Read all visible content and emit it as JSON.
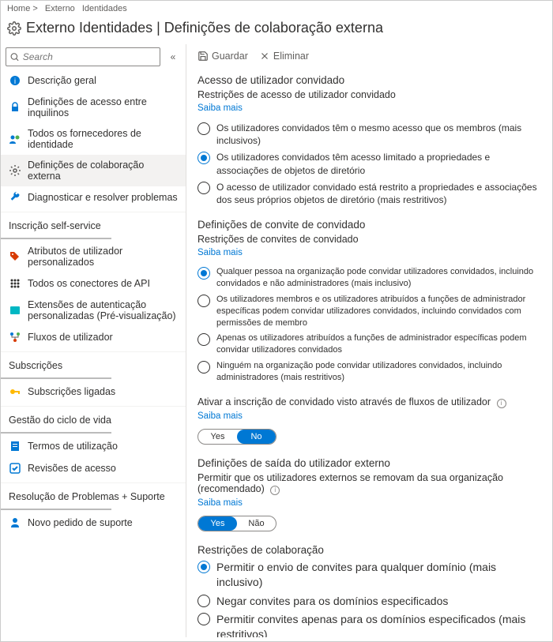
{
  "breadcrumb": {
    "home": "Home >",
    "l1": "Externo",
    "l2": "Identidades"
  },
  "header": {
    "title": "Externo  Identidades | Definições de colaboração externa"
  },
  "sidebar": {
    "search_placeholder": "Search",
    "items": [
      {
        "label": "Descrição geral",
        "icon": "info",
        "color": "#0078d4"
      },
      {
        "label": "Definições de acesso entre inquilinos",
        "icon": "lock",
        "color": "#0078d4"
      },
      {
        "label": "Todos os fornecedores de identidade",
        "icon": "people",
        "color": "#0078d4"
      },
      {
        "label": "Definições de colaboração externa",
        "icon": "gear",
        "color": "#605e5c",
        "selected": true
      },
      {
        "label": "Diagnosticar e resolver problemas",
        "icon": "wrench",
        "color": "#0078d4"
      }
    ],
    "groups": [
      {
        "label": "Inscrição self-service",
        "items": [
          {
            "label": "Atributos de utilizador personalizados",
            "icon": "tag",
            "color": "#d83b01"
          },
          {
            "label": "Todos os conectores de API",
            "icon": "grid",
            "color": "#323130"
          },
          {
            "label": "Extensões de autenticação personalizadas (Pré-visualização)",
            "icon": "square",
            "color": "#00b7c3"
          },
          {
            "label": "Fluxos de utilizador",
            "icon": "flow",
            "color": "#107c10"
          }
        ]
      },
      {
        "label": "Subscrições",
        "items": [
          {
            "label": "Subscrições ligadas",
            "icon": "key",
            "color": "#ffb900"
          }
        ]
      },
      {
        "label": "Gestão do ciclo de vida",
        "items": [
          {
            "label": "Termos de utilização",
            "icon": "doc",
            "color": "#0078d4"
          },
          {
            "label": "Revisões de acesso",
            "icon": "check",
            "color": "#0078d4"
          }
        ]
      },
      {
        "label": "Resolução de Problemas + Suporte",
        "items": [
          {
            "label": "Novo pedido de suporte",
            "icon": "person",
            "color": "#0078d4"
          }
        ]
      }
    ]
  },
  "toolbar": {
    "save_label": "Guardar",
    "delete_label": "Eliminar"
  },
  "sections": {
    "guest_access": {
      "title": "Acesso de utilizador convidado",
      "sub": "Restrições de acesso de utilizador convidado",
      "learn": "Saiba mais",
      "options": [
        "Os utilizadores convidados têm o mesmo acesso que os membros (mais inclusivos)",
        "Os utilizadores convidados têm acesso limitado a propriedades e associações de objetos de diretório",
        "O acesso de utilizador convidado está restrito a propriedades e associações dos seus próprios objetos de diretório (mais restritivos)"
      ],
      "selected": 1
    },
    "invite": {
      "title": "Definições de convite de convidado",
      "sub": "Restrições de convites de convidado",
      "learn": "Saiba mais",
      "options": [
        "Qualquer pessoa na organização pode convidar utilizadores convidados, incluindo convidados e não administradores (mais inclusivo)",
        "Os utilizadores membros e os utilizadores atribuídos a funções de administrador específicas podem convidar utilizadores convidados, incluindo convidados com permissões de membro",
        "Apenas os utilizadores atribuídos a funções de administrador específicas podem convidar utilizadores convidados",
        "Ninguém na organização pode convidar utilizadores convidados, incluindo administradores (mais restritivos)"
      ],
      "selected": 0
    },
    "signup": {
      "label": "Ativar a inscrição de convidado visto através de fluxos de utilizador",
      "learn": "Saiba mais",
      "yes": "Yes",
      "no": "No",
      "value": "No"
    },
    "leave": {
      "title": "Definições de saída do utilizador externo",
      "sub": "Permitir que os utilizadores externos se removam da sua organização (recomendado)",
      "learn": "Saiba mais",
      "yes": "Yes",
      "no": "Não",
      "value": "Yes"
    },
    "collab": {
      "title": "Restrições de colaboração",
      "options": [
        "Permitir o envio de convites para qualquer domínio (mais inclusivo)",
        "Negar convites para os domínios especificados",
        "Permitir convites apenas para os domínios especificados (mais restritivos)"
      ],
      "selected": 0
    }
  }
}
